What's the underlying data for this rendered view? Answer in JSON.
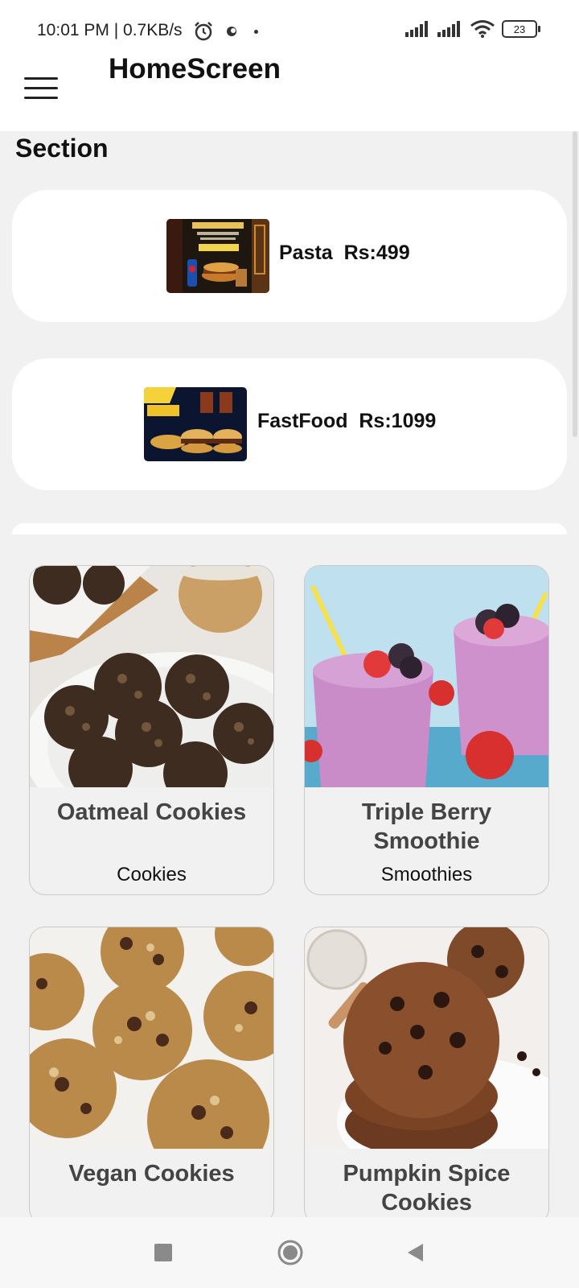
{
  "status_bar": {
    "time": "10:01 PM | 0.7KB/s",
    "battery": "23",
    "icons": [
      "alarm-icon",
      "notification-dot",
      "signal-icon",
      "signal-icon",
      "wifi-icon",
      "battery-icon"
    ]
  },
  "app_bar": {
    "title": "HomeScreen",
    "menu_icon": "hamburger-menu-icon"
  },
  "section": {
    "title": "Section",
    "items": [
      {
        "label": "Pasta  Rs:499",
        "image": "pasta-deal-photo"
      },
      {
        "label": "FastFood  Rs:1099",
        "image": "fastfood-deal-photo"
      }
    ]
  },
  "grid": {
    "items": [
      {
        "name": "Oatmeal Cookies",
        "category": "Cookies",
        "image": "oatmeal-cookies-photo"
      },
      {
        "name": "Triple Berry Smoothie",
        "category": "Smoothies",
        "image": "berry-smoothie-photo"
      },
      {
        "name": "Vegan Cookies",
        "category": "",
        "image": "vegan-cookies-photo"
      },
      {
        "name": "Pumpkin Spice Cookies",
        "category": "",
        "image": "pumpkin-cookies-photo"
      }
    ]
  },
  "nav_bar": {
    "buttons": [
      "recents-square-icon",
      "home-circle-icon",
      "back-triangle-icon"
    ]
  }
}
